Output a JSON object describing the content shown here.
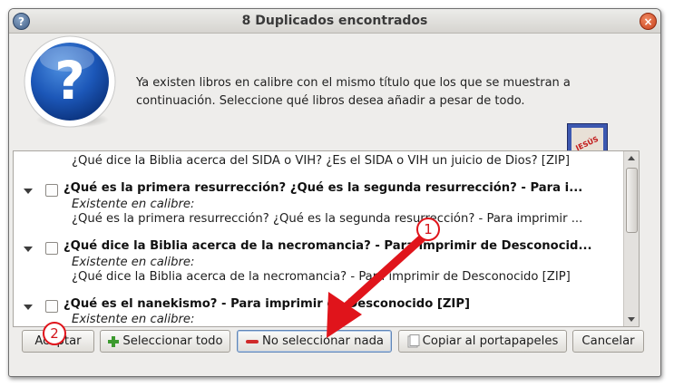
{
  "window": {
    "title": "8 Duplicados encontrados"
  },
  "message": "Ya existen libros en calibre con el mismo título que los que se muestran a continuación. Seleccione qué libros desea añadir a pesar de todo.",
  "book_cover": {
    "text": "JESÚS"
  },
  "list": {
    "top_partial_line": "¿Qué dice la Biblia acerca del SIDA o VIH? ¿Es el SIDA o VIH un juicio de Dios? [ZIP]",
    "items": [
      {
        "title": "¿Qué es la primera resurrección? ¿Qué es la segunda resurrección? - Para i...",
        "existing_label": "Existente en calibre:",
        "existing_entry": "¿Qué es la primera resurrección? ¿Qué es la segunda resurrección? - Para imprimir ..."
      },
      {
        "title": "¿Qué dice la Biblia acerca de la necromancia? - Para imprimir de Desconocid...",
        "existing_label": "Existente en calibre:",
        "existing_entry": "¿Qué dice la Biblia acerca de la necromancia? - Para imprimir de Desconocido [ZIP]"
      },
      {
        "title": "¿Qué es el nanekismo? - Para imprimir de Desconocido [ZIP]",
        "existing_label": "Existente en calibre:"
      }
    ]
  },
  "buttons": {
    "accept": "Aceptar",
    "select_all": "Seleccionar todo",
    "select_none": "No seleccionar nada",
    "copy_clipboard": "Copiar al portapapeles",
    "cancel": "Cancelar"
  },
  "annotations": {
    "marker_1": "1",
    "marker_2": "2",
    "arrow_color": "#e0141b"
  },
  "colors": {
    "annotation_red": "#e0141b",
    "focus_blue": "#5f86b8"
  }
}
